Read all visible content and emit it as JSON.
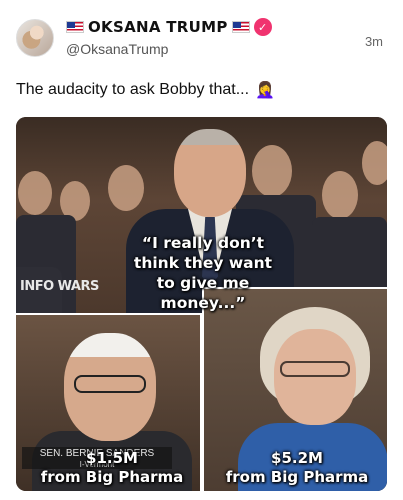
{
  "post": {
    "display_name": "OKSANA TRUMP",
    "handle": "@OksanaTrump",
    "timestamp": "3m",
    "text": "The audacity to ask Bobby that...",
    "emoji": "🤦‍♀️"
  },
  "icons": {
    "flag_left": "us-flag-icon",
    "flag_right": "us-flag-icon",
    "verified": "verified-badge-icon",
    "facepalm": "woman-facepalming-emoji"
  },
  "meme": {
    "quote": "“I really don’t think they want to give me money...”",
    "watermark": "INFO WARS",
    "nameplate_line1": "SEN. BERNIE SANDERS",
    "nameplate_line2": "I-Vermont",
    "left_caption_amount": "$1.5M",
    "left_caption_source": "from Big Pharma",
    "right_caption_amount": "$5.2M",
    "right_caption_source": "from Big Pharma"
  },
  "colors": {
    "verified_badge": "#f0336f",
    "flag_red": "#c8102e",
    "flag_blue": "#1f3a93"
  }
}
